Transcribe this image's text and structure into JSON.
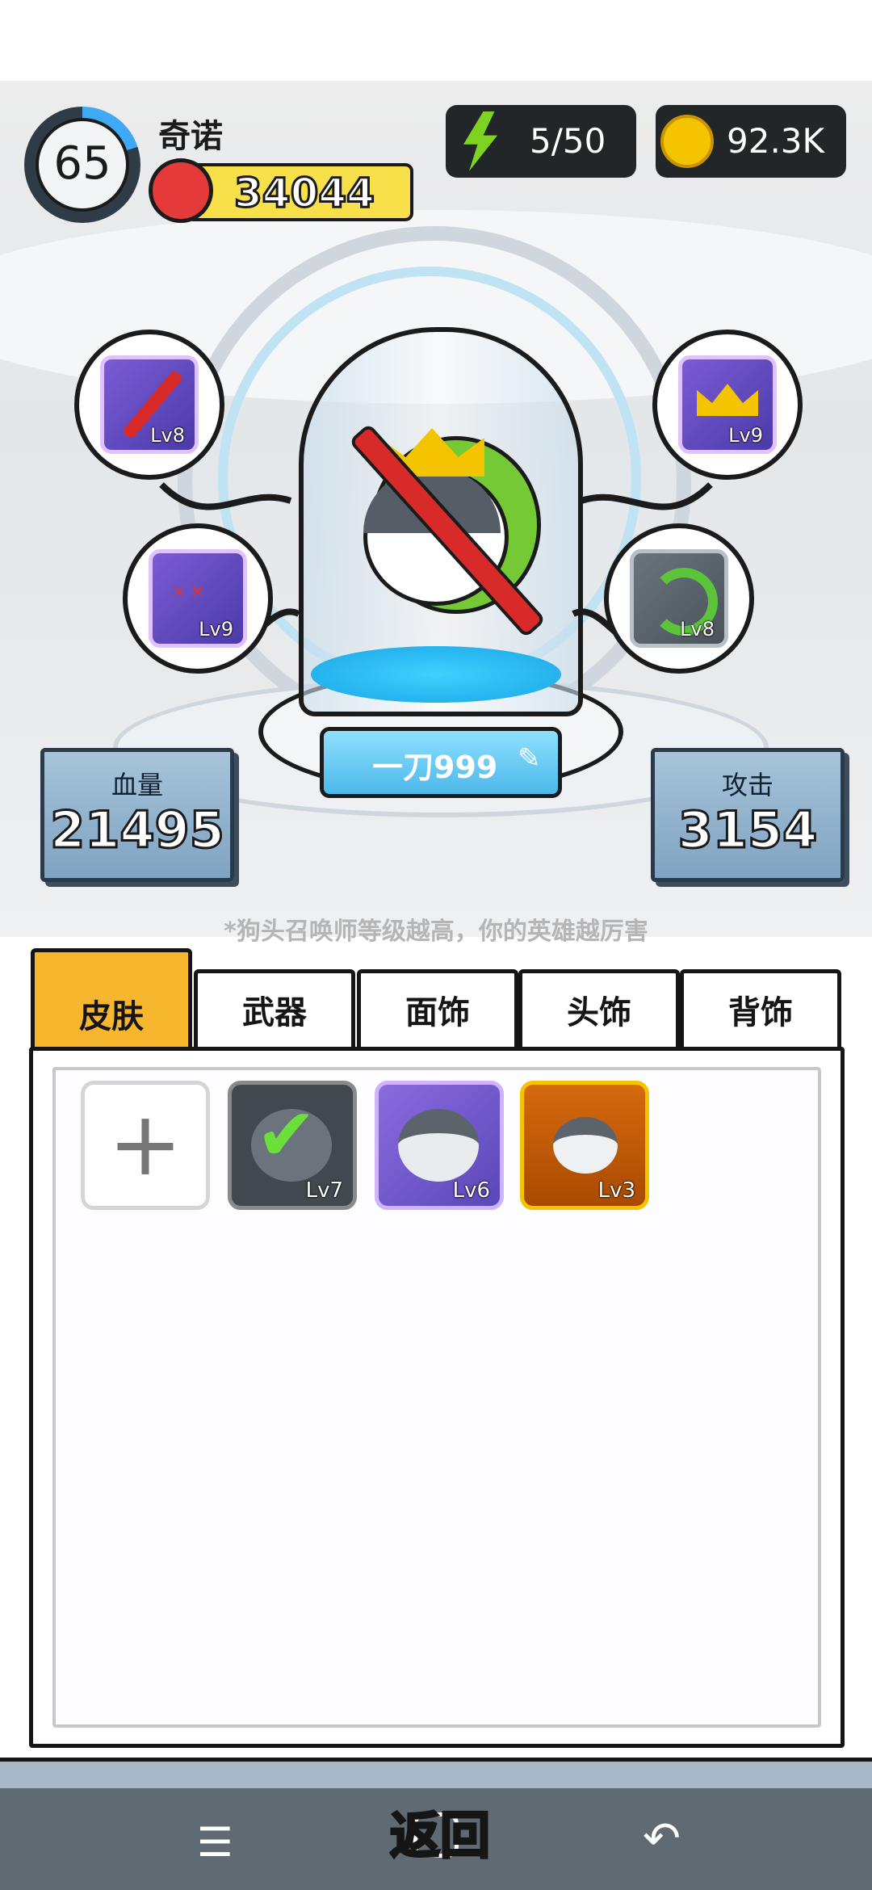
{
  "player": {
    "level": "65",
    "name": "奇诺",
    "power": "34044",
    "level_ring_fraction": 0.2
  },
  "resources": {
    "energy": "5/50",
    "coins": "92.3K"
  },
  "equipment": {
    "weapon": {
      "level": "Lv8"
    },
    "crown": {
      "level": "Lv9"
    },
    "face": {
      "level": "Lv9"
    },
    "back": {
      "level": "Lv8"
    }
  },
  "hero": {
    "name": "一刀999"
  },
  "stats": {
    "hp_label": "血量",
    "hp_value": "21495",
    "atk_label": "攻击",
    "atk_value": "3154"
  },
  "tip": "*狗头召唤师等级越高，你的英雄越厉害",
  "tabs": [
    {
      "label": "皮肤",
      "active": true
    },
    {
      "label": "武器"
    },
    {
      "label": "面饰"
    },
    {
      "label": "头饰"
    },
    {
      "label": "背饰"
    }
  ],
  "skins": [
    {
      "level": "Lv7",
      "equipped": true
    },
    {
      "level": "Lv6"
    },
    {
      "level": "Lv3"
    }
  ],
  "back_button": "返回",
  "colors": {
    "accent_tab": "#f6b62e",
    "nav_bar": "#5f6a73",
    "gold": "#f5c400"
  }
}
